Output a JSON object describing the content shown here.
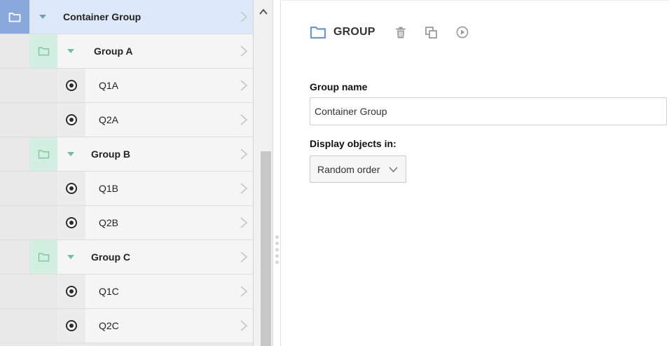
{
  "tree": {
    "items": [
      {
        "label": "Container Group",
        "level": 0,
        "kind": "group",
        "icon": "folder-icon"
      },
      {
        "label": "Group A",
        "level": 1,
        "kind": "group",
        "icon": "folder-icon"
      },
      {
        "label": "Q1A",
        "level": 2,
        "kind": "question",
        "icon": "radio-icon"
      },
      {
        "label": "Q2A",
        "level": 2,
        "kind": "question",
        "icon": "radio-icon"
      },
      {
        "label": "Group B",
        "level": 1,
        "kind": "group",
        "icon": "folder-icon"
      },
      {
        "label": "Q1B",
        "level": 2,
        "kind": "question",
        "icon": "radio-icon"
      },
      {
        "label": "Q2B",
        "level": 2,
        "kind": "question",
        "icon": "radio-icon"
      },
      {
        "label": "Group C",
        "level": 1,
        "kind": "group",
        "icon": "folder-icon"
      },
      {
        "label": "Q1C",
        "level": 2,
        "kind": "question",
        "icon": "radio-icon"
      },
      {
        "label": "Q2C",
        "level": 2,
        "kind": "question",
        "icon": "radio-icon"
      }
    ]
  },
  "detail": {
    "header_title": "GROUP",
    "tools": [
      "trash-icon",
      "duplicate-icon",
      "play-icon"
    ],
    "group_name_label": "Group name",
    "group_name_value": "Container Group",
    "display_label": "Display objects in:",
    "display_value": "Random order"
  },
  "colors": {
    "selected_row": "#dde9f9",
    "folder_blue": "#89a9dc",
    "folder_green": "#d2efe2",
    "caret_green": "#6fbf9f"
  }
}
